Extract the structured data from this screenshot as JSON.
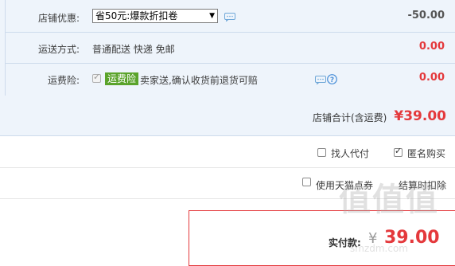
{
  "shop": {
    "discount_label": "店铺优惠:",
    "discount_selected": "省50元:爆款折扣卷",
    "discount_amount": "-50.00",
    "shipping_label": "运送方式:",
    "shipping_value": "普通配送 快递 免邮",
    "shipping_amount": "0.00",
    "insurance_label": "运费险:",
    "insurance_tag": "运费险",
    "insurance_desc": "卖家送,确认收货前退货可赔",
    "insurance_amount": "0.00",
    "total_label": "店铺合计(含运费)",
    "total_amount": "¥39.00"
  },
  "options": {
    "proxy_pay": "找人代付",
    "anonymous": "匿名购买",
    "tmall_points": "使用天猫点券",
    "points_note": "结算时扣除"
  },
  "payment": {
    "label": "实付款:",
    "currency": "¥",
    "amount": "39.00"
  },
  "watermark": {
    "text": "值",
    "sub": "smzdm.com"
  },
  "colors": {
    "price_red": "#e4393c",
    "tag_green": "#5aa32b",
    "panel_bg": "#eef4fb"
  }
}
